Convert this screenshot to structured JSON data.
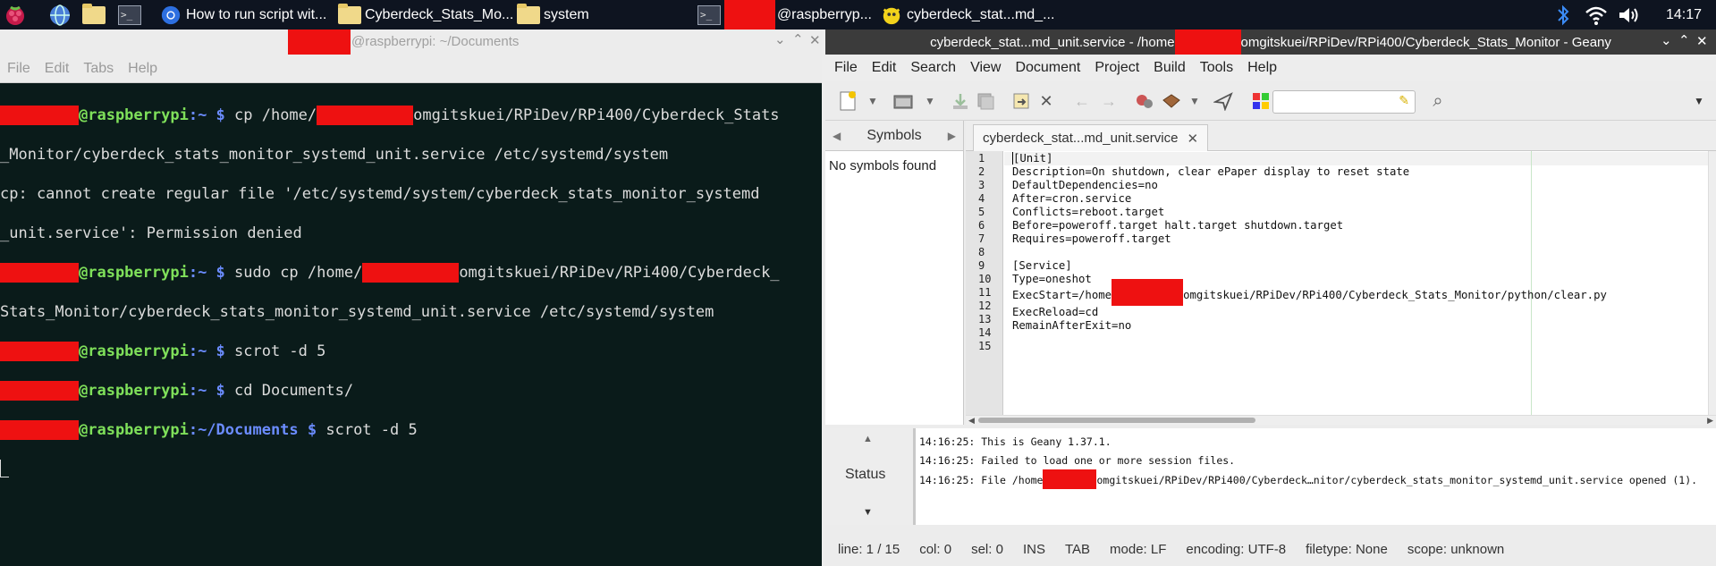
{
  "taskbar": {
    "tasks": [
      {
        "label": "How to run script wit..."
      },
      {
        "label": "Cyberdeck_Stats_Mo..."
      },
      {
        "label": "system"
      },
      {
        "label": "@raspberryp..."
      },
      {
        "label": "cyberdeck_stat...md_..."
      }
    ],
    "clock": "14:17"
  },
  "terminal": {
    "title": "@raspberrypi: ~/Documents",
    "menu": [
      "File",
      "Edit",
      "Tabs",
      "Help"
    ],
    "lines": [
      {
        "prompt": "@raspberrypi",
        "path": ":~ $",
        "text": " cp /home/",
        "text2": "omgitskuei/RPiDev/RPi400/Cyberdeck_Stats"
      },
      {
        "text": "_Monitor/cyberdeck_stats_monitor_systemd_unit.service /etc/systemd/system"
      },
      {
        "text": "cp: cannot create regular file '/etc/systemd/system/cyberdeck_stats_monitor_systemd"
      },
      {
        "text": "_unit.service': Permission denied"
      },
      {
        "prompt": "@raspberrypi",
        "path": ":~ $",
        "text": " sudo cp /home/",
        "text2": "omgitskuei/RPiDev/RPi400/Cyberdeck_"
      },
      {
        "text": "Stats_Monitor/cyberdeck_stats_monitor_systemd_unit.service /etc/systemd/system"
      },
      {
        "prompt": "@raspberrypi",
        "path": ":~ $",
        "text": " scrot -d 5"
      },
      {
        "prompt": "@raspberrypi",
        "path": ":~ $",
        "text": " cd Documents/"
      },
      {
        "prompt": "@raspberrypi",
        "path": ":~/Documents $",
        "text": " scrot -d 5"
      }
    ]
  },
  "geany": {
    "title_left": "cyberdeck_stat...md_unit.service - /home",
    "title_right": "omgitskuei/RPiDev/RPi400/Cyberdeck_Stats_Monitor - Geany",
    "menu": [
      "File",
      "Edit",
      "Search",
      "View",
      "Document",
      "Project",
      "Build",
      "Tools",
      "Help"
    ],
    "sidebar_tab": "Symbols",
    "sidebar_empty": "No symbols found",
    "file_tab": "cyberdeck_stat...md_unit.service",
    "line_numbers": "1\n2\n3\n4\n5\n6\n7\n8\n9\n10\n11\n12\n13\n14\n15",
    "code": {
      "l1": "[Unit]",
      "l2": "Description=On shutdown, clear ePaper display to reset state",
      "l3": "DefaultDependencies=no",
      "l4": "After=cron.service",
      "l5": "Conflicts=reboot.target",
      "l6": "Before=poweroff.target halt.target shutdown.target",
      "l7": "Requires=poweroff.target",
      "l9": "[Service]",
      "l10": "Type=oneshot",
      "l11a": "ExecStart=/home",
      "l11b": "omgitskuei/RPiDev/RPi400/Cyberdeck_Stats_Monitor/python/clear.py",
      "l12": "ExecReload=cd",
      "l13": "RemainAfterExit=no"
    },
    "msg_tab": "Status",
    "messages": {
      "m1": "14:16:25: This is Geany 1.37.1.",
      "m2": "14:16:25: Failed to load one or more session files.",
      "m3a": "14:16:25: File /home",
      "m3b": "omgitskuei/RPiDev/RPi400/Cyberdeck…nitor/cyberdeck_stats_monitor_systemd_unit.service opened (1)."
    },
    "status": {
      "line": "line: 1 / 15",
      "col": "col: 0",
      "sel": "sel: 0",
      "ins": "INS",
      "tab": "TAB",
      "mode": "mode: LF",
      "encoding": "encoding: UTF-8",
      "filetype": "filetype: None",
      "scope": "scope: unknown"
    }
  }
}
